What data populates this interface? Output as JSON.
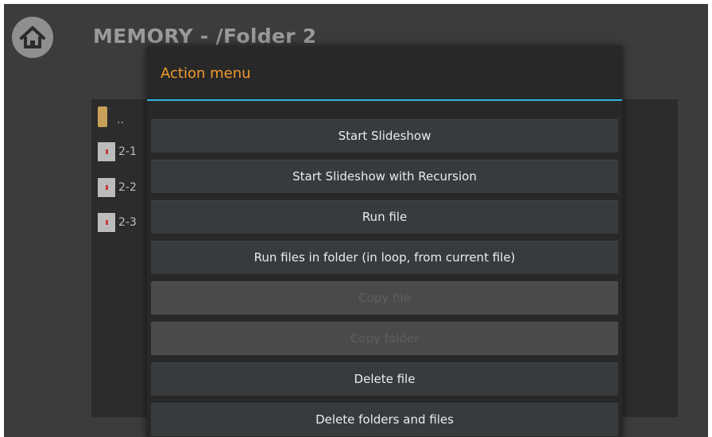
{
  "header": {
    "title": "MEMORY - /Folder 2",
    "home_icon": "home-icon"
  },
  "file_list": {
    "items": [
      {
        "label": "..",
        "icon": "folder-icon"
      },
      {
        "label": "2-1",
        "icon": "file-icon"
      },
      {
        "label": "2-2",
        "icon": "file-icon"
      },
      {
        "label": "2-3",
        "icon": "file-icon"
      }
    ]
  },
  "dialog": {
    "title": "Action menu",
    "accent_color": "#2fb3e0",
    "title_color": "#ef9a2c",
    "items": [
      {
        "label": "Start Slideshow",
        "enabled": true
      },
      {
        "label": "Start Slideshow with Recursion",
        "enabled": true
      },
      {
        "label": "Run file",
        "enabled": true
      },
      {
        "label": "Run files in folder (in loop, from current file)",
        "enabled": true
      },
      {
        "label": "Copy file",
        "enabled": false
      },
      {
        "label": "Copy folder",
        "enabled": false
      },
      {
        "label": "Delete file",
        "enabled": true
      },
      {
        "label": "Delete folders and files",
        "enabled": true
      }
    ]
  }
}
